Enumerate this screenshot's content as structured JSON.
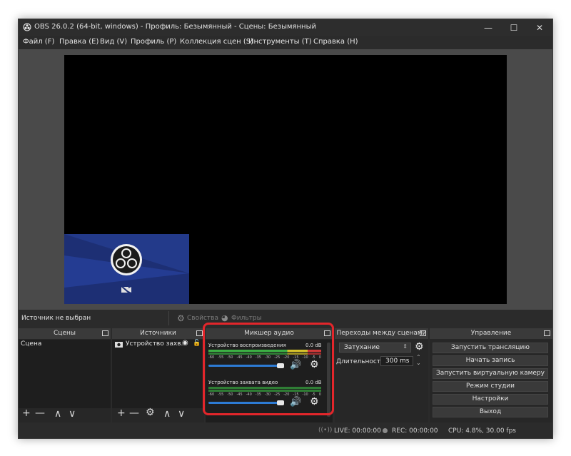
{
  "window": {
    "title": "OBS 26.0.2 (64-bit, windows) - Профиль: Безымянный - Сцены: Безымянный",
    "minimize_glyph": "—",
    "maximize_glyph": "☐",
    "close_glyph": "✕"
  },
  "menu": [
    "Файл (F)",
    "Правка (E)",
    "Вид (V)",
    "Профиль (P)",
    "Коллекция сцен (S)",
    "Инструменты (T)",
    "Справка (H)"
  ],
  "source_bar": {
    "status": "Источник не выбран",
    "properties": "Свойства",
    "filters": "Фильтры"
  },
  "scenes": {
    "header": "Сцены",
    "items": [
      "Сцена"
    ]
  },
  "sources": {
    "header": "Источники",
    "items": [
      "Устройство захв."
    ]
  },
  "mixer": {
    "header": "Микшер аудио",
    "highlight_color": "#e3262b",
    "channels": [
      {
        "name": "Устройство воспроизведения",
        "level": "0.0 dB",
        "ticks": [
          "-60",
          "-55",
          "-50",
          "-45",
          "-40",
          "-35",
          "-30",
          "-25",
          "-20",
          "-15",
          "-10",
          "-5",
          "0"
        ]
      },
      {
        "name": "Устройство захвата видео",
        "level": "0.0 dB",
        "ticks": [
          "-60",
          "-55",
          "-50",
          "-45",
          "-40",
          "-35",
          "-30",
          "-25",
          "-20",
          "-15",
          "-10",
          "-5",
          "0"
        ]
      }
    ]
  },
  "transitions": {
    "header": "Переходы между сценами",
    "type": "Затухание",
    "duration_label": "Длительность",
    "duration_value": "300 ms"
  },
  "controls": {
    "header": "Управление",
    "buttons": [
      "Запустить трансляцию",
      "Начать запись",
      "Запустить виртуальную камеру",
      "Режим студии",
      "Настройки",
      "Выход"
    ]
  },
  "status": {
    "live": "LIVE: 00:00:00",
    "rec": "REC: 00:00:00",
    "cpu": "CPU: 4.8%, 30.00 fps"
  },
  "colors": {
    "accent_blue": "#2d7bd4",
    "meter_green": "#3cb044",
    "meter_yellow": "#d6c22b",
    "meter_red": "#d23a3a"
  }
}
